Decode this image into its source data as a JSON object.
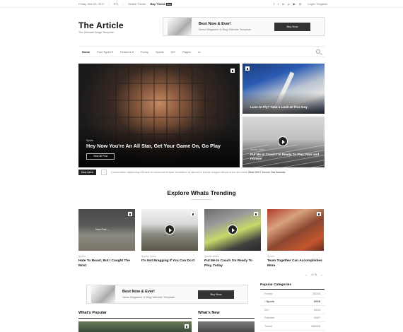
{
  "topbar": {
    "date": "Friday, Mar 03, 2017",
    "rtl": "RTL",
    "mobile_theme": "Mobile Theme",
    "buy_theme": "Buy Theme",
    "buy_badge": "New",
    "login": "Login / Register",
    "social_icons": [
      "facebook-icon",
      "twitter-icon",
      "linkedin-icon",
      "pinterest-icon",
      "youtube-icon",
      "instagram-icon"
    ]
  },
  "logo": {
    "title": "The Article",
    "tagline": "The Ultimate Blogs Template"
  },
  "ad": {
    "title": "Best Now & Ever!",
    "subtitle": "News Magazine & Blog Website Template.",
    "button": "Buy Now"
  },
  "nav": {
    "items": [
      "Home",
      "Post Types ▾",
      "Features ▾",
      "Funny",
      "Sports",
      "DIY",
      "Pages",
      "•••"
    ]
  },
  "hero": {
    "main": {
      "category": "Sports",
      "title": "Hey Now You're An All Star, Get Your Game On, Go Play",
      "button": "View All Post"
    },
    "right1": {
      "title": "Love to Fly? Take a Look at This Guy"
    },
    "right2": {
      "category": "Sports, Video",
      "title": "Put Me In Coach I'm Ready To Play, Now and Forever"
    }
  },
  "ticker": {
    "label": "Daily Alerts",
    "prev": "‹",
    "text": "Consectetur adipiscing elit sed do eiusmod tempor incididunt ut labore et dolore magna aliqua enim ad minim",
    "highlight": "Best 2017 Knock Out Awards."
  },
  "trending": {
    "title": "Explore Whats Trending",
    "cards": [
      {
        "category": "Sports",
        "title": "Hate To Boast, But I Caught The Most",
        "overlay": "View Post →"
      },
      {
        "category": "Sports, Video",
        "title": "It's Not Bragging If You Can Do It"
      },
      {
        "category": "Sports, Audio",
        "title": "Put Me In Coach I'm Ready To Play, Today"
      },
      {
        "category": "Sports",
        "title": "Team Together Can Accomplishes More"
      }
    ],
    "pager": {
      "prev": "←",
      "count": "1 / 3",
      "next": "→"
    }
  },
  "popular_categories": {
    "title": "Popular Categories",
    "rows": [
      {
        "name": "Funny",
        "count": "28245"
      },
      {
        "name": "› Sports",
        "count": "8558"
      },
      {
        "name": "DIY",
        "count": "8434"
      },
      {
        "name": "Fashion",
        "count": "6587"
      },
      {
        "name": "Travel",
        "count": "488658"
      }
    ]
  },
  "sections": {
    "popular": "What's Popular",
    "new": "What's New"
  }
}
